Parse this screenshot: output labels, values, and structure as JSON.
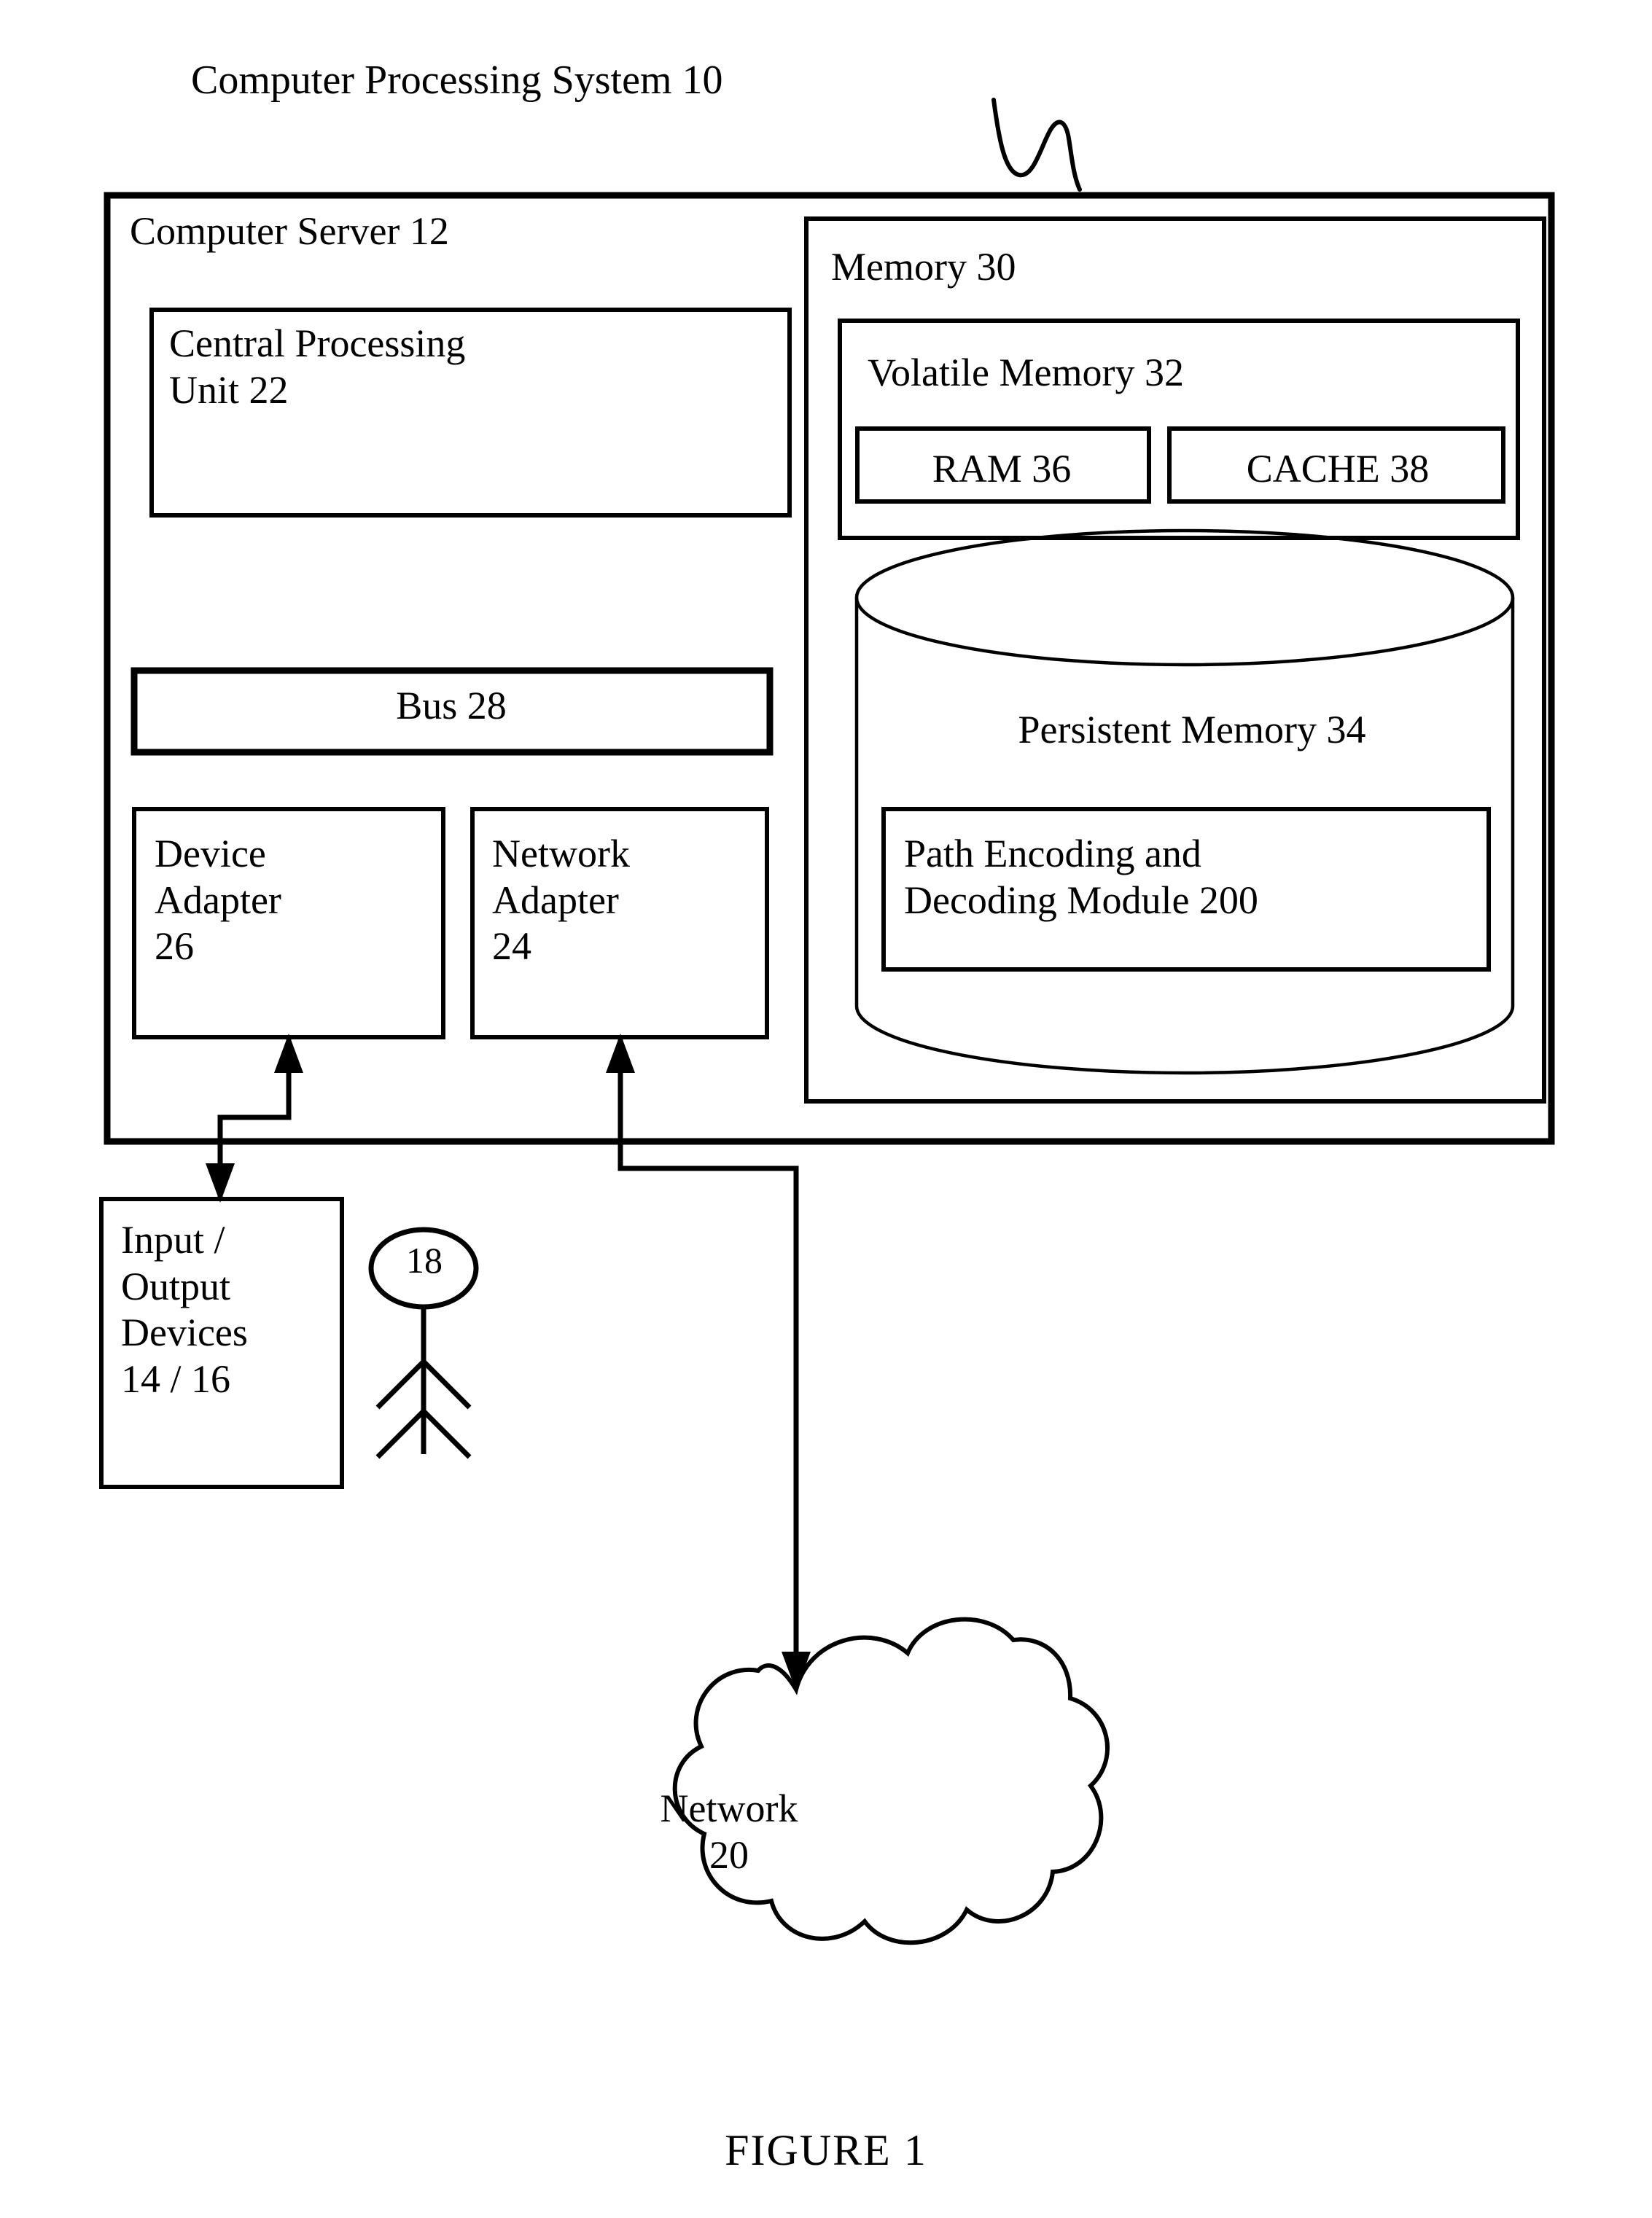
{
  "figure": {
    "caption": "FIGURE 1",
    "system_title": "Computer Processing System 10",
    "lead_mark": "squiggle-reference-mark"
  },
  "diagram": {
    "type": "block-diagram",
    "outer_container": {
      "name": "computer-server",
      "label": "Computer Server 12"
    },
    "blocks": [
      {
        "id": "cpu",
        "label": "Central Processing\nUnit 22",
        "parent": "computer-server",
        "shape": "rect"
      },
      {
        "id": "bus",
        "label": "Bus 28",
        "parent": "computer-server",
        "shape": "rect"
      },
      {
        "id": "device-adapter",
        "label": "Device\nAdapter\n26",
        "parent": "computer-server",
        "shape": "rect"
      },
      {
        "id": "network-adapter",
        "label": "Network\nAdapter\n24",
        "parent": "computer-server",
        "shape": "rect"
      },
      {
        "id": "memory",
        "label": "Memory 30",
        "parent": "computer-server",
        "shape": "rect"
      },
      {
        "id": "volatile-memory",
        "label": "Volatile Memory 32",
        "parent": "memory",
        "shape": "rect"
      },
      {
        "id": "ram",
        "label": "RAM 36",
        "parent": "volatile-memory",
        "shape": "rect"
      },
      {
        "id": "cache",
        "label": "CACHE 38",
        "parent": "volatile-memory",
        "shape": "rect"
      },
      {
        "id": "persistent-memory",
        "label": "Persistent Memory 34",
        "parent": "memory",
        "shape": "cylinder"
      },
      {
        "id": "path-module",
        "label": "Path Encoding and\nDecoding Module 200",
        "parent": "persistent-memory",
        "shape": "rect"
      },
      {
        "id": "io-devices",
        "label": "Input /\nOutput\nDevices\n14 / 16",
        "parent": "page",
        "shape": "rect"
      },
      {
        "id": "network-cloud",
        "label": "Network\n20",
        "parent": "page",
        "shape": "cloud"
      },
      {
        "id": "user",
        "label": "18",
        "parent": "page",
        "shape": "stick-figure"
      }
    ],
    "connectors": [
      {
        "from": "io-devices",
        "to": "device-adapter",
        "style": "double-arrow-elbow"
      },
      {
        "from": "network-cloud",
        "to": "network-adapter",
        "style": "double-arrow-elbow"
      }
    ]
  },
  "labels": {
    "system_title": "Computer Processing System 10",
    "server": "Computer Server 12",
    "cpu": "Central Processing\nUnit 22",
    "bus": "Bus 28",
    "device_adapter": "Device\nAdapter\n26",
    "network_adapter": "Network\nAdapter\n24",
    "memory": "Memory 30",
    "volatile_memory": "Volatile Memory 32",
    "ram": "RAM 36",
    "cache": "CACHE 38",
    "persistent_memory": "Persistent Memory 34",
    "path_module": "Path Encoding and\nDecoding Module 200",
    "io_devices": "Input /\nOutput\nDevices\n14 / 16",
    "user_number": "18",
    "network": "Network\n20",
    "figure_caption": "FIGURE 1"
  },
  "colors": {
    "ink": "#000000",
    "paper": "#ffffff"
  }
}
